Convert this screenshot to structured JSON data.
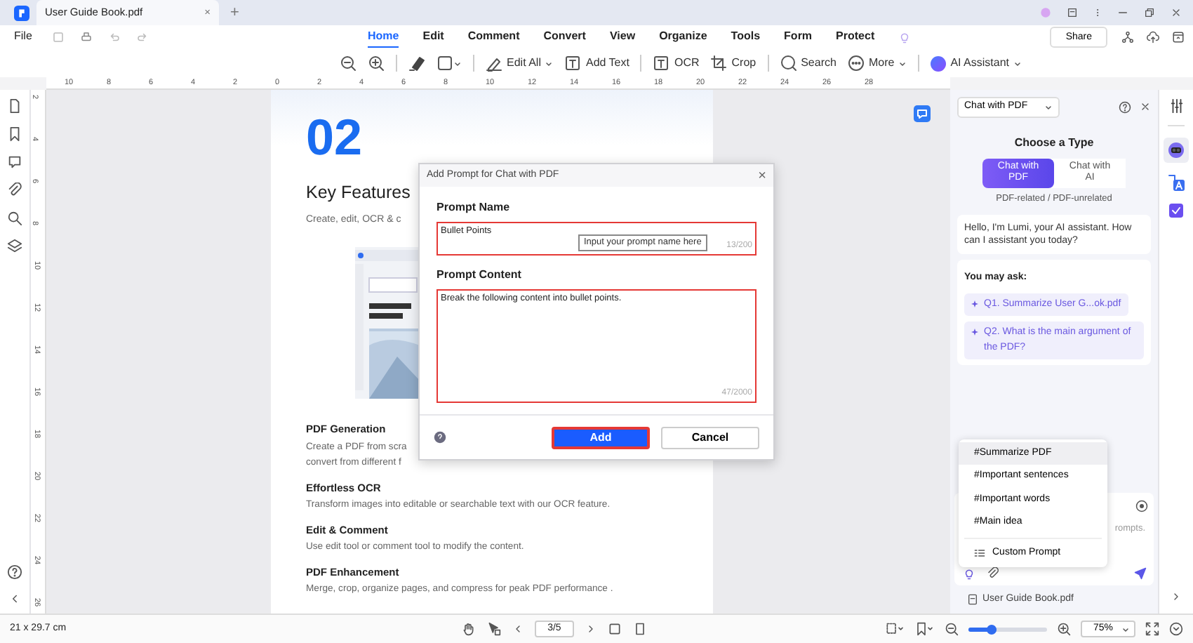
{
  "window": {
    "tab_title": "User Guide Book.pdf",
    "tab_close": "×",
    "new_tab": "+"
  },
  "menu": {
    "file": "File",
    "tabs": [
      {
        "label": "Home",
        "selected": true
      },
      {
        "label": "Edit",
        "selected": false
      },
      {
        "label": "Comment",
        "selected": false
      },
      {
        "label": "Convert",
        "selected": false
      },
      {
        "label": "View",
        "selected": false
      },
      {
        "label": "Organize",
        "selected": false
      },
      {
        "label": "Tools",
        "selected": false
      },
      {
        "label": "Form",
        "selected": false
      },
      {
        "label": "Protect",
        "selected": false
      }
    ],
    "share": "Share"
  },
  "toolbar": [
    {
      "label": "Edit All",
      "kind": "dropdown"
    },
    {
      "label": "Add Text",
      "kind": "plain"
    },
    {
      "label": "OCR",
      "kind": "plain"
    },
    {
      "label": "Crop",
      "kind": "plain"
    },
    {
      "label": "Search",
      "kind": "plain"
    },
    {
      "label": "More",
      "kind": "dropdown"
    },
    {
      "label": "AI Assistant",
      "kind": "dropdown"
    }
  ],
  "ruler": {
    "horizontal": [
      "10",
      "8",
      "6",
      "4",
      "2",
      "0",
      "2",
      "4",
      "6",
      "8",
      "10",
      "12",
      "14",
      "16",
      "18",
      "20",
      "22",
      "24",
      "26",
      "28"
    ],
    "vertical": [
      "2",
      "4",
      "6",
      "8",
      "10",
      "12",
      "14",
      "16",
      "18",
      "20",
      "22",
      "24",
      "26"
    ]
  },
  "page": {
    "number": "02",
    "title": "Key Features",
    "subtitle": "Create, edit, OCR & c",
    "sections": [
      {
        "heading": "PDF Generation",
        "lines": [
          "Create a PDF from scra",
          "convert from different f"
        ]
      },
      {
        "heading": "Effortless OCR",
        "lines": [
          "Transform images into editable or searchable text with our OCR feature."
        ]
      },
      {
        "heading": "Edit & Comment",
        "lines": [
          "Use edit tool or comment tool to modify the content."
        ]
      },
      {
        "heading": "PDF Enhancement",
        "lines": [
          "Merge, crop, organize pages, and compress for peak PDF performance ."
        ]
      }
    ]
  },
  "dialog": {
    "title": "Add Prompt for Chat with PDF",
    "close": "×",
    "name_label": "Prompt Name",
    "name_value": "Bullet Points",
    "name_tooltip": "Input your prompt name here",
    "name_counter": "13/200",
    "content_label": "Prompt Content",
    "content_value": "Break the following content into bullet points.",
    "content_counter": "47/2000",
    "buttons": [
      {
        "label": "Add",
        "kind": "primary"
      },
      {
        "label": "Cancel",
        "kind": "secondary"
      }
    ]
  },
  "ai_panel": {
    "mode": "Chat with PDF",
    "heading": "Choose a Type",
    "types": [
      {
        "label": "Chat with PDF",
        "selected": true
      },
      {
        "label": "Chat with AI",
        "selected": false
      }
    ],
    "types_caption": "PDF-related / PDF-unrelated",
    "greeting": "Hello, I'm Lumi, your AI assistant. How can I assistant you today?",
    "suggest_title": "You may ask:",
    "suggestions": [
      "Q1. Summarize User G...ok.pdf",
      "Q2. What is the main argument of the PDF?"
    ],
    "input_placeholder": "rompts.",
    "file": "User Guide Book.pdf"
  },
  "prompt_menu": {
    "items": [
      {
        "label": "#Summarize PDF",
        "selected": true
      },
      {
        "label": "#Important sentences",
        "selected": false
      },
      {
        "label": "#Important words",
        "selected": false
      },
      {
        "label": "#Main idea",
        "selected": false
      }
    ],
    "custom": "Custom Prompt"
  },
  "status_bar": {
    "page_size": "21 x 29.7 cm",
    "page": "3/5",
    "zoom": "75%",
    "zoom_level": {
      "level": 0.35
    }
  }
}
